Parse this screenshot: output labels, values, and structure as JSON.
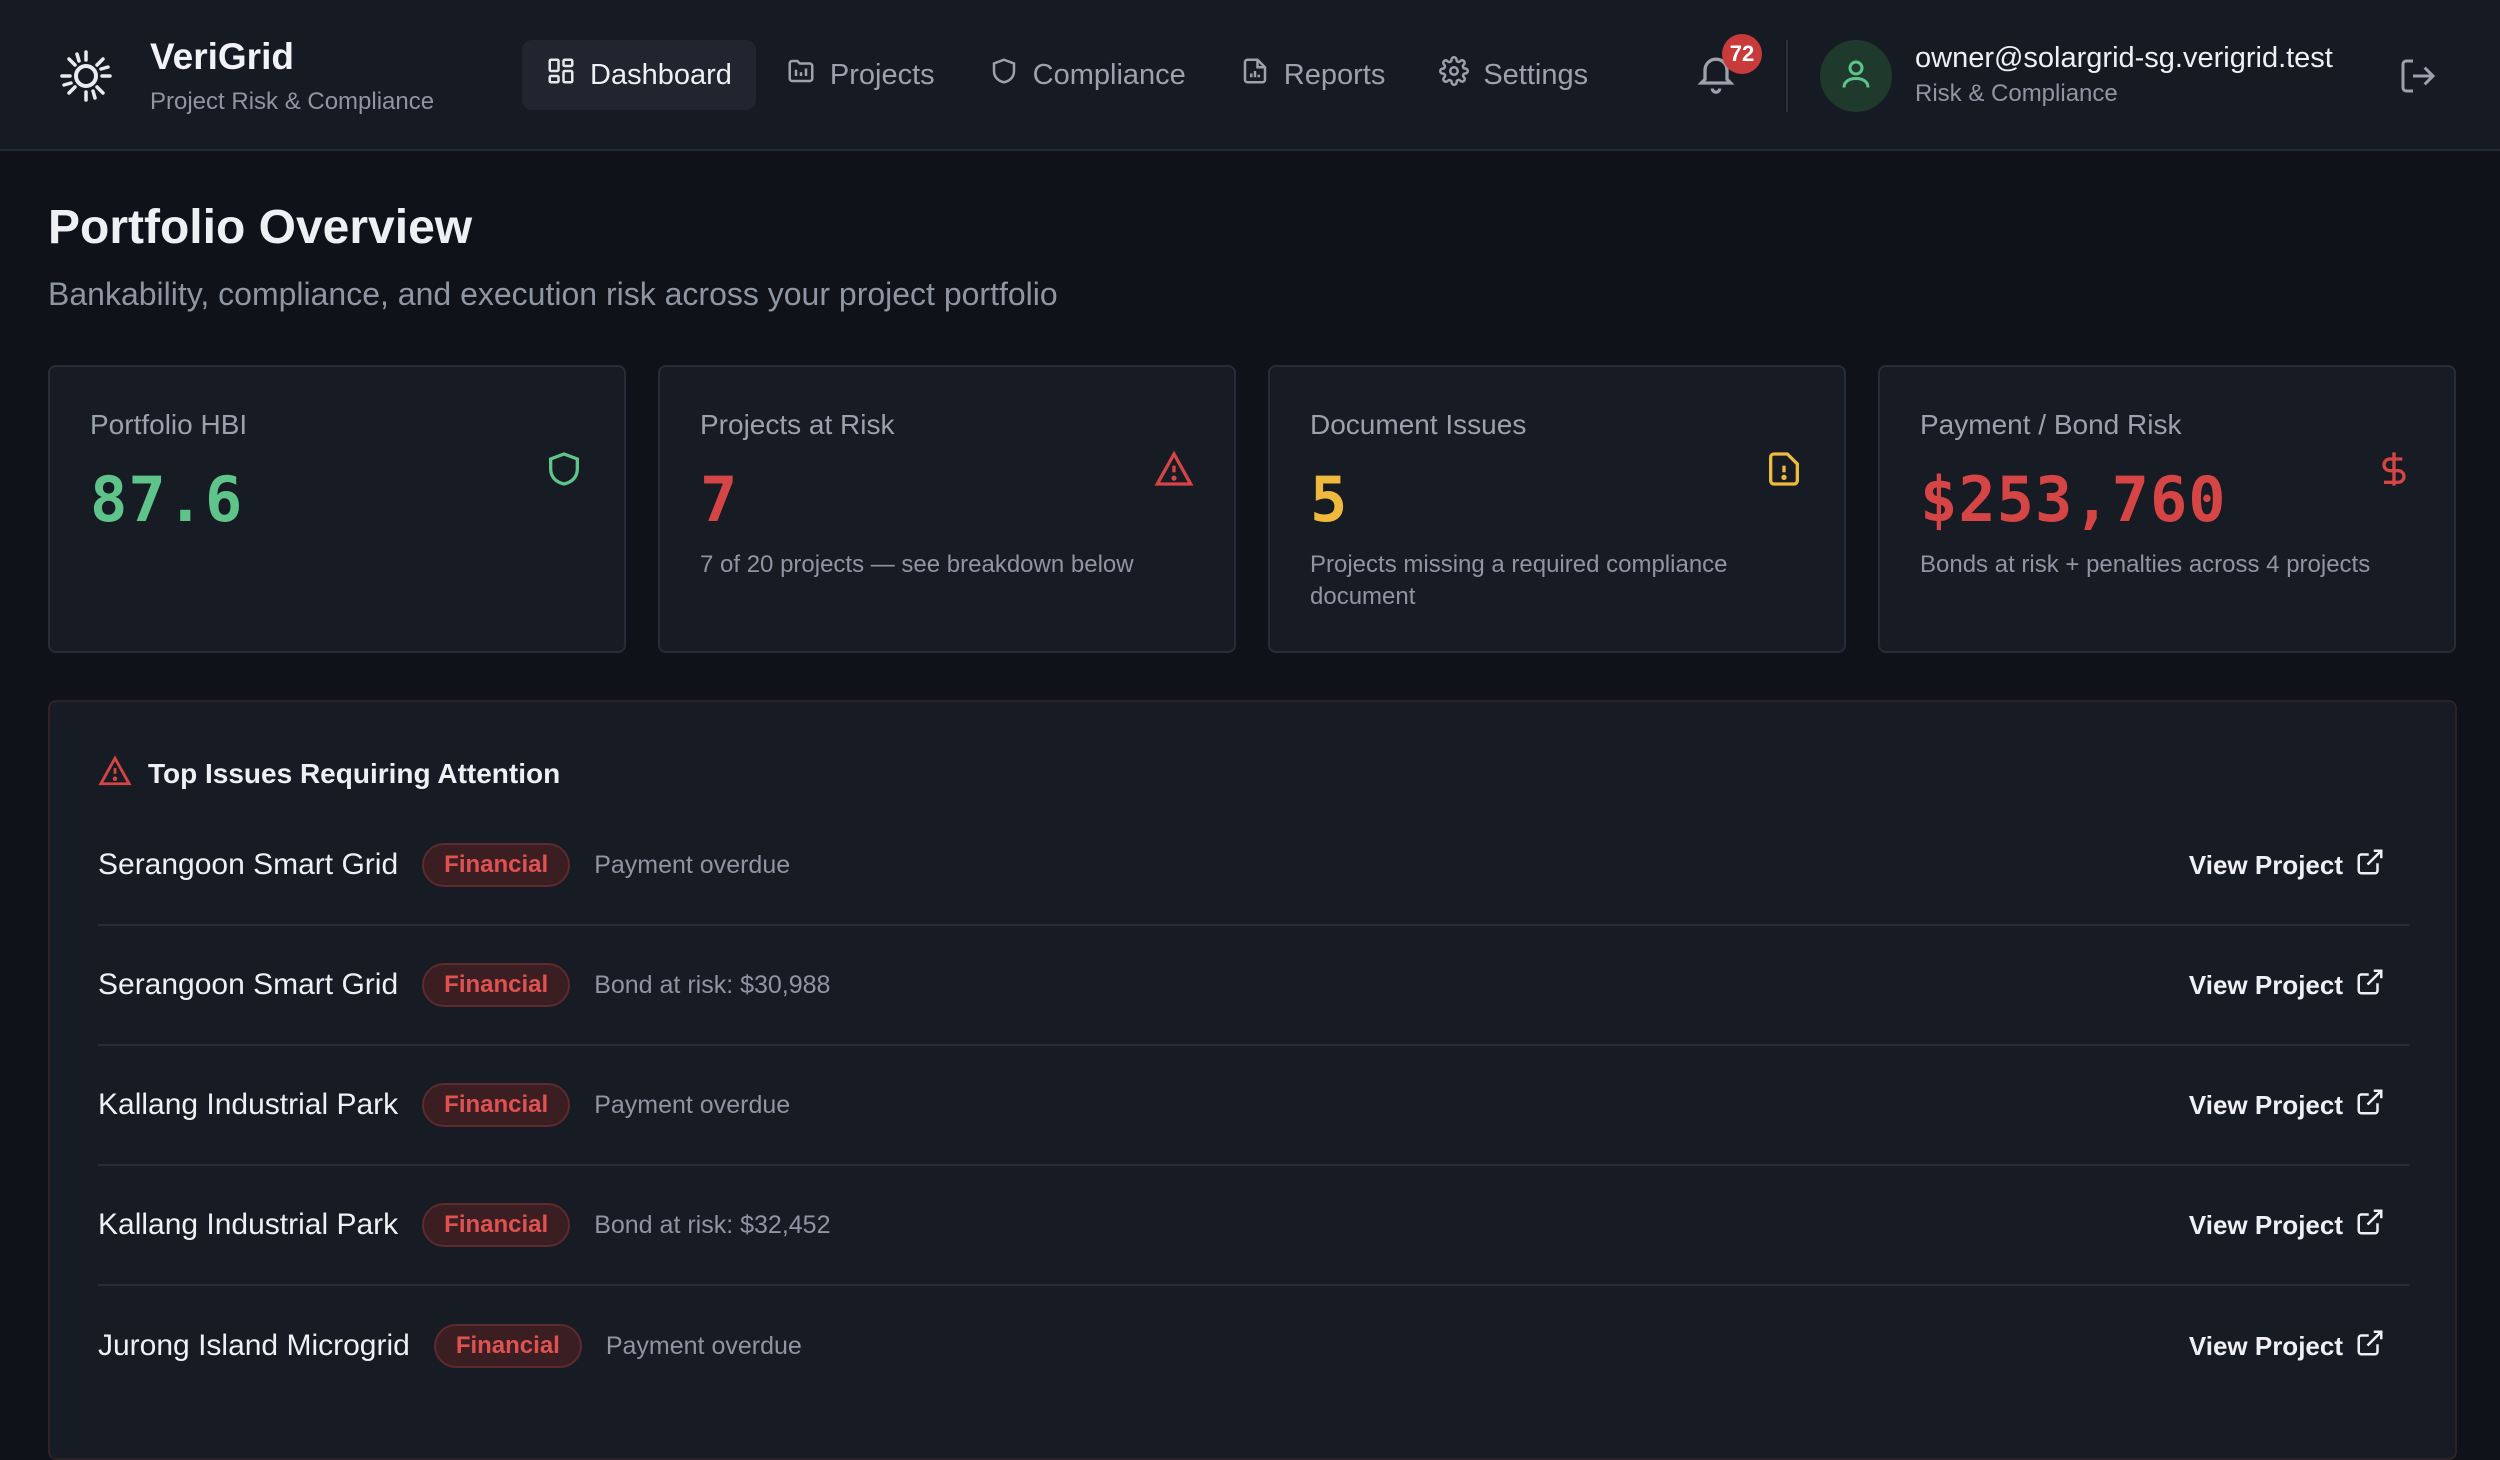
{
  "brand": {
    "name": "VeriGrid",
    "tagline": "Project Risk & Compliance"
  },
  "nav": {
    "items": [
      {
        "label": "Dashboard",
        "icon": "grid-icon",
        "active": true
      },
      {
        "label": "Projects",
        "icon": "folder-chart-icon",
        "active": false
      },
      {
        "label": "Compliance",
        "icon": "shield-icon",
        "active": false
      },
      {
        "label": "Reports",
        "icon": "file-chart-icon",
        "active": false
      },
      {
        "label": "Settings",
        "icon": "gear-icon",
        "active": false
      }
    ]
  },
  "notifications": {
    "count": "72"
  },
  "user": {
    "email": "owner@solargrid-sg.verigrid.test",
    "role": "Risk & Compliance"
  },
  "page": {
    "title": "Portfolio Overview",
    "subtitle": "Bankability, compliance, and execution risk across your project portfolio"
  },
  "cards": [
    {
      "label": "Portfolio HBI",
      "value": "87.6",
      "note": "",
      "icon": "shield-icon",
      "color": "#5fc48a"
    },
    {
      "label": "Projects at Risk",
      "value": "7",
      "note": "7 of 20 projects — see breakdown below",
      "icon": "warning-triangle-icon",
      "color": "#d64545"
    },
    {
      "label": "Document Issues",
      "value": "5",
      "note": "Projects missing a required compliance document",
      "icon": "file-alert-icon",
      "color": "#efb93d"
    },
    {
      "label": "Payment / Bond Risk",
      "value": "$253,760",
      "note": "Bonds at risk + penalties across 4 projects",
      "icon": "dollar-icon",
      "color": "#d64545"
    }
  ],
  "issues": {
    "title": "Top Issues Requiring Attention",
    "link_label": "View Project",
    "rows": [
      {
        "project": "Serangoon Smart Grid",
        "tag": "Financial",
        "desc": "Payment overdue"
      },
      {
        "project": "Serangoon Smart Grid",
        "tag": "Financial",
        "desc": "Bond at risk: $30,988"
      },
      {
        "project": "Kallang Industrial Park",
        "tag": "Financial",
        "desc": "Payment overdue"
      },
      {
        "project": "Kallang Industrial Park",
        "tag": "Financial",
        "desc": "Bond at risk: $32,452"
      },
      {
        "project": "Jurong Island Microgrid",
        "tag": "Financial",
        "desc": "Payment overdue"
      }
    ]
  }
}
